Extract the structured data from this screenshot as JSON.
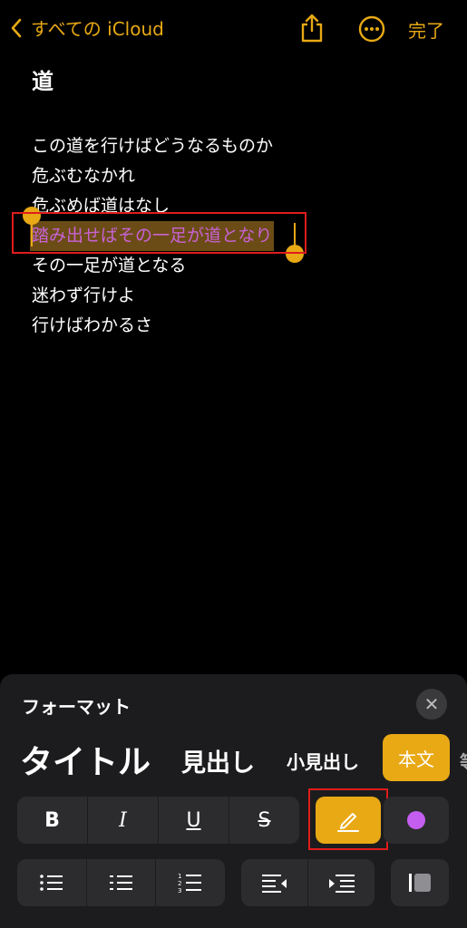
{
  "nav": {
    "back_label": "すべての iCloud",
    "done_label": "完了",
    "back_icon": "chevron-left-icon",
    "share_icon": "share-icon",
    "more_icon": "ellipsis-circle-icon"
  },
  "note": {
    "title": "道",
    "lines": [
      "この道を行けばどうなるものか",
      "危ぶむなかれ",
      "危ぶめば道はなし",
      "踏み出せばその一足が道となり",
      "その一足が道となる",
      "迷わず行けよ",
      "行けばわかるさ"
    ],
    "selected_line_index": 3
  },
  "format_panel": {
    "title": "フォーマット",
    "close_icon": "close-icon",
    "styles": {
      "title": "タイトル",
      "heading": "見出し",
      "subheading": "小見出し",
      "body": "本文",
      "partial": "等"
    },
    "text_buttons": {
      "bold": "B",
      "italic": "I",
      "underline": "U",
      "strike": "S"
    },
    "accent_color": "#e8a915",
    "highlight_color": "#c45ef0"
  }
}
